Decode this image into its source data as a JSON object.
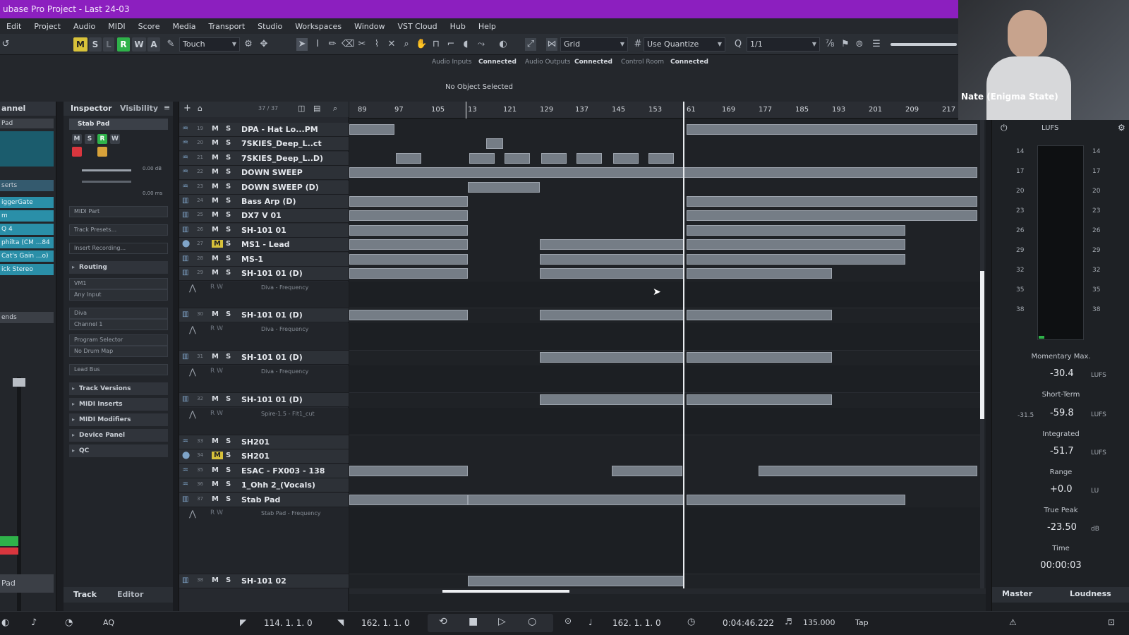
{
  "window": {
    "title": "ubase Pro Project - Last 24-03"
  },
  "menu": [
    "Edit",
    "Project",
    "Audio",
    "MIDI",
    "Score",
    "Media",
    "Transport",
    "Studio",
    "Workspaces",
    "Window",
    "VST Cloud",
    "Hub",
    "Help"
  ],
  "toolbar": {
    "mode_buttons": [
      "M",
      "S",
      "L",
      "R",
      "W",
      "A"
    ],
    "automation_mode": "Touch",
    "snap_type": "Grid",
    "quantize_mode": "Use Quantize",
    "quantize_value": "1/1"
  },
  "status": {
    "audio_inputs_label": "Audio Inputs",
    "audio_inputs_value": "Connected",
    "audio_outputs_label": "Audio Outputs",
    "audio_outputs_value": "Connected",
    "control_room_label": "Control Room",
    "control_room_value": "Connected",
    "info_line": "No Object Selected"
  },
  "channel_strip": {
    "header": "annel",
    "track_name": "Pad",
    "inserts_label": "serts",
    "inserts": [
      "iggerGate",
      "m",
      "Q 4",
      "philta (CM ...84",
      "Cat's Gain ...o)",
      "ick Stereo"
    ],
    "sends_label": "ends",
    "footer": "Pad"
  },
  "inspector": {
    "tab_inspector": "Inspector",
    "tab_visibility": "Visibility",
    "track_name": "Stab Pad",
    "volume": "0.00 dB",
    "delay": "0.00 ms",
    "midi_part": "MIDI Part",
    "track_presets": "Track Presets...",
    "insert_recording": "Insert Recording...",
    "routing": "Routing",
    "midi_input": "VM1",
    "any_input": "Any Input",
    "output": "Diva",
    "channel": "Channel 1",
    "program_selector": "Program Selector",
    "drum_map": "No Drum Map",
    "patch": "Lead Bus",
    "sections": [
      "Track Versions",
      "MIDI Inserts",
      "MIDI Modifiers",
      "Device Panel",
      "QC"
    ],
    "bottom_tab_track": "Track",
    "bottom_tab_editor": "Editor"
  },
  "track_list": {
    "counter": "37 / 37",
    "tracks": [
      {
        "num": "19",
        "name": "DPA - Hat Lo...PM"
      },
      {
        "num": "20",
        "name": "7SKIES_Deep_L..ct"
      },
      {
        "num": "21",
        "name": "7SKIES_Deep_L..D)"
      },
      {
        "num": "22",
        "name": "DOWN SWEEP"
      },
      {
        "num": "23",
        "name": "DOWN SWEEP (D)"
      },
      {
        "num": "24",
        "name": "Bass Arp (D)"
      },
      {
        "num": "25",
        "name": "DX7 V 01"
      },
      {
        "num": "26",
        "name": "SH-101 01"
      },
      {
        "num": "27",
        "name": "MS1 - Lead"
      },
      {
        "num": "28",
        "name": "MS-1"
      },
      {
        "num": "29",
        "name": "SH-101 01 (D)"
      },
      {
        "num": "30",
        "name": "SH-101 01 (D)"
      },
      {
        "num": "31",
        "name": "SH-101 01 (D)"
      },
      {
        "num": "32",
        "name": "SH-101 01 (D)"
      },
      {
        "num": "33",
        "name": "SH201"
      },
      {
        "num": "34",
        "name": "SH201"
      },
      {
        "num": "35",
        "name": "ESAC - FX003 - 138"
      },
      {
        "num": "36",
        "name": "1_Ohh 2_(Vocals)"
      },
      {
        "num": "37",
        "name": "Stab Pad"
      },
      {
        "num": "38",
        "name": "SH-101 02"
      }
    ],
    "automation_lanes": [
      "Diva - Frequency",
      "Diva - Frequency",
      "Diva - Frequency",
      "Spire-1.5 - Flt1_cut",
      "Stab Pad - Frequency"
    ]
  },
  "ruler": {
    "bars": [
      "89",
      "97",
      "105",
      "13",
      "121",
      "129",
      "137",
      "145",
      "153",
      "61",
      "169",
      "177",
      "185",
      "193",
      "201",
      "209",
      "217"
    ]
  },
  "loudness": {
    "header": "LUFS",
    "scale": [
      "14",
      "17",
      "20",
      "23",
      "26",
      "29",
      "32",
      "35",
      "38"
    ],
    "momentary_max_label": "Momentary Max.",
    "momentary_max_value": "-30.4",
    "momentary_max_unit": "LUFS",
    "short_term_label": "Short-Term",
    "short_term_value": "-59.8",
    "short_term_extra": "-31.5",
    "short_term_unit": "LUFS",
    "integrated_label": "Integrated",
    "integrated_value": "-51.7",
    "integrated_unit": "LUFS",
    "range_label": "Range",
    "range_value": "+0.0",
    "range_unit": "LU",
    "true_peak_label": "True Peak",
    "true_peak_value": "-23.50",
    "true_peak_unit": "dB",
    "time_label": "Time",
    "time_value": "00:00:03",
    "tab_master": "Master",
    "tab_loudness": "Loudness"
  },
  "webcam": {
    "caption": "Nate (Enigma State)"
  },
  "transport": {
    "aq": "AQ",
    "left_locator": "114. 1. 1.   0",
    "right_locator": "162. 1. 1.   0",
    "position": "162. 1. 1.   0",
    "time": "0:04:46.222",
    "tempo": "135.000",
    "tap": "Tap"
  },
  "colors": {
    "title_bar": "#8c1fbf",
    "accent_green": "#2fb24a",
    "accent_yellow": "#d8c23a",
    "insert_teal": "#2a8fa8",
    "record_red": "#d9363e"
  }
}
